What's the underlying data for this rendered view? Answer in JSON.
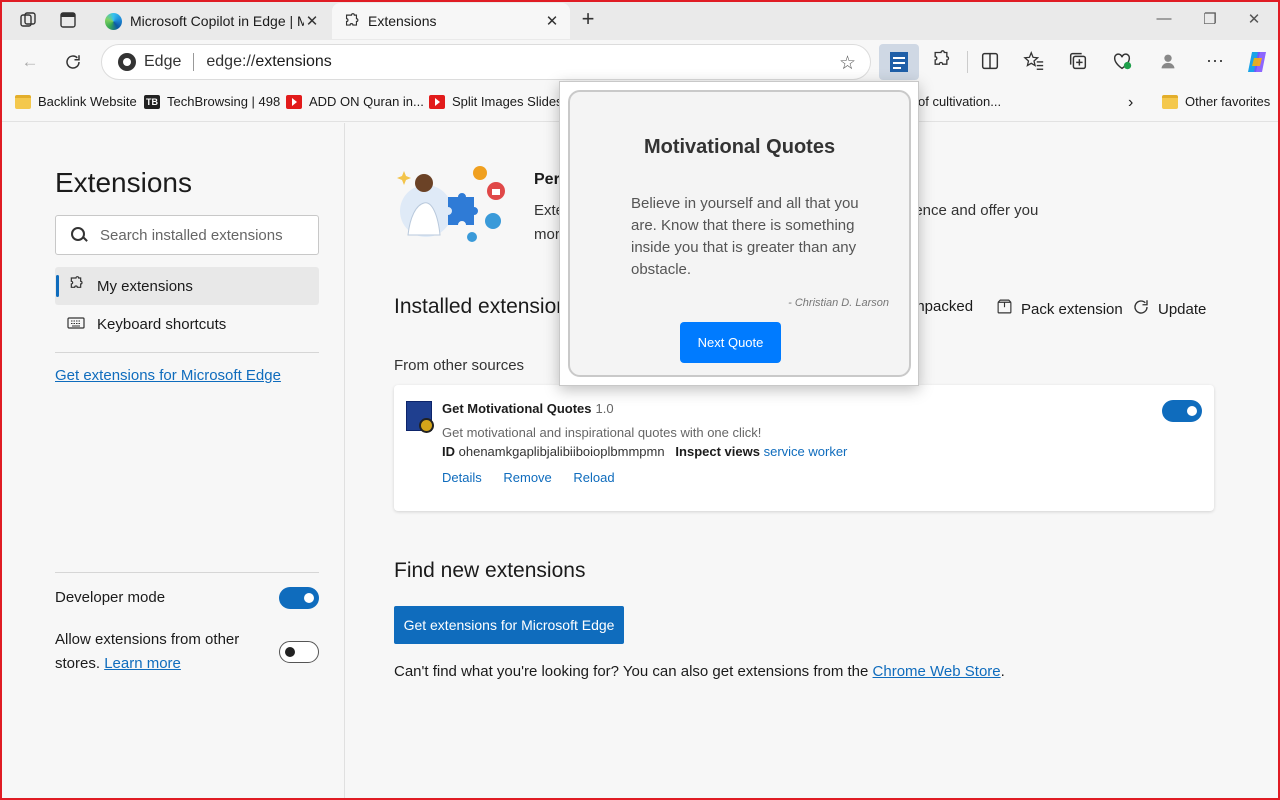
{
  "tabs": [
    {
      "title": "Microsoft Copilot in Edge | Micro"
    },
    {
      "title": "Extensions"
    }
  ],
  "address": {
    "site": "Edge",
    "url_prefix": "edge://",
    "url_path": "extensions"
  },
  "favorites": [
    {
      "label": "Backlink Website",
      "icon": "folder-icon"
    },
    {
      "label": "TechBrowsing | 498",
      "icon": "techbrowsing-icon"
    },
    {
      "label": "ADD ON Quran in...",
      "icon": "youtube-icon"
    },
    {
      "label": "Split Images Slides...",
      "icon": "youtube-icon"
    },
    {
      "label": "of cultivation...",
      "icon": "youtube-icon"
    },
    {
      "label": "Other favorites",
      "icon": "folder-icon"
    }
  ],
  "sidebar": {
    "title": "Extensions",
    "search_placeholder": "Search installed extensions",
    "items": [
      {
        "label": "My extensions",
        "icon": "puzzle-icon"
      },
      {
        "label": "Keyboard shortcuts",
        "icon": "keyboard-icon"
      }
    ],
    "get_link": "Get extensions for Microsoft Edge",
    "developer_mode": {
      "label": "Developer mode",
      "on": true
    },
    "allow_other": {
      "label_line1": "Allow extensions from other",
      "label_line2": "stores.",
      "learn_more": "Learn more",
      "on": false
    }
  },
  "main": {
    "persona": {
      "title": "Per",
      "line1": "Exte",
      "line2": "mor",
      "line1_right": "ience and offer you"
    },
    "installed_heading": "Installed extension",
    "actions": [
      {
        "label": "unpacked",
        "icon": "folder-open-icon"
      },
      {
        "label": "Pack extension",
        "icon": "package-icon"
      },
      {
        "label": "Update",
        "icon": "refresh-icon"
      }
    ],
    "from_other_sources": "From other sources",
    "extension": {
      "name": "Get Motivational Quotes",
      "version": "1.0",
      "description": "Get motivational and inspirational quotes with one click!",
      "id_label": "ID",
      "id_value": "ohenamkgaplibjalibiiboioplbmmpmn",
      "inspect_label": "Inspect views",
      "inspect_link": "service worker",
      "links": [
        "Details",
        "Remove",
        "Reload"
      ],
      "enabled": true
    },
    "find_heading": "Find new extensions",
    "get_button": "Get extensions for Microsoft Edge",
    "cant_find_prefix": "Can't find what you're looking for? You can also get extensions from the",
    "cant_find_link": "Chrome Web Store",
    "cant_find_suffix": "."
  },
  "popup": {
    "title": "Motivational Quotes",
    "quote": "Believe in yourself and all that you are. Know that there is something inside you that is greater than any obstacle.",
    "author": "- Christian D. Larson",
    "button": "Next Quote"
  },
  "colors": {
    "accent": "#0f6cbd",
    "popup_button": "#007bff",
    "frame": "#e01c24"
  }
}
